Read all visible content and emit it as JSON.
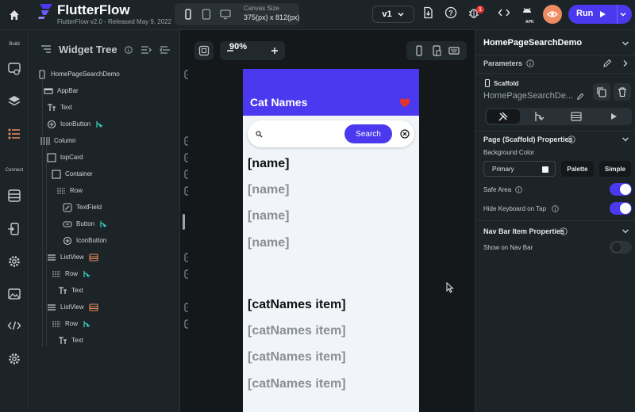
{
  "app": {
    "brand": "FlutterFlow",
    "version_line": "FlutterFlow v2.0 - Released May 9, 2022"
  },
  "toolbar": {
    "canvas_size_label": "Canvas Size",
    "canvas_size_value": "375(px) x 812(px)",
    "version_select": "v1",
    "notification_count": "1",
    "apk_label": "APK",
    "run_label": "Run",
    "colors": {
      "accent": "#4b39ef",
      "preview": "#ee8b60",
      "alert": "#e5322d"
    }
  },
  "left_nav": {
    "build_label": "Build",
    "connect_label": "Connect"
  },
  "widget_tree": {
    "title": "Widget Tree",
    "rows": [
      {
        "label": "HomePageSearchDemo"
      },
      {
        "label": "AppBar"
      },
      {
        "label": "Text"
      },
      {
        "label": "IconButton"
      },
      {
        "label": "Column"
      },
      {
        "label": "topCard"
      },
      {
        "label": "Container"
      },
      {
        "label": "Row"
      },
      {
        "label": "TextField"
      },
      {
        "label": "Button"
      },
      {
        "label": "IconButton"
      },
      {
        "label": "ListView"
      },
      {
        "label": "Row"
      },
      {
        "label": "Text"
      },
      {
        "label": "ListView"
      },
      {
        "label": "Row"
      },
      {
        "label": "Text"
      }
    ]
  },
  "canvas": {
    "zoom": "90%",
    "phone": {
      "app_title": "Cat Names",
      "search_button": "Search",
      "list1": [
        "[name]",
        "[name]",
        "[name]",
        "[name]"
      ],
      "list2": [
        "[catNames item]",
        "[catNames item]",
        "[catNames item]",
        "[catNames item]"
      ]
    }
  },
  "properties": {
    "page_name": "HomePageSearchDemo",
    "parameters_label": "Parameters",
    "widget_type": "Scaffold",
    "widget_name": "HomePageSearchDe...",
    "section_title": "Page (Scaffold) Properties",
    "bg_color_label": "Background Color",
    "bg_color_value": "Primary",
    "palette_button": "Palette",
    "simple_button": "Simple",
    "safe_area_label": "Safe Area",
    "safe_area_on": true,
    "hide_keyboard_label": "Hide Keyboard on Tap",
    "hide_keyboard_on": true,
    "nav_section_title": "Nav Bar Item Properties",
    "show_nav_label": "Show on Nav Bar",
    "show_nav_on": false
  }
}
